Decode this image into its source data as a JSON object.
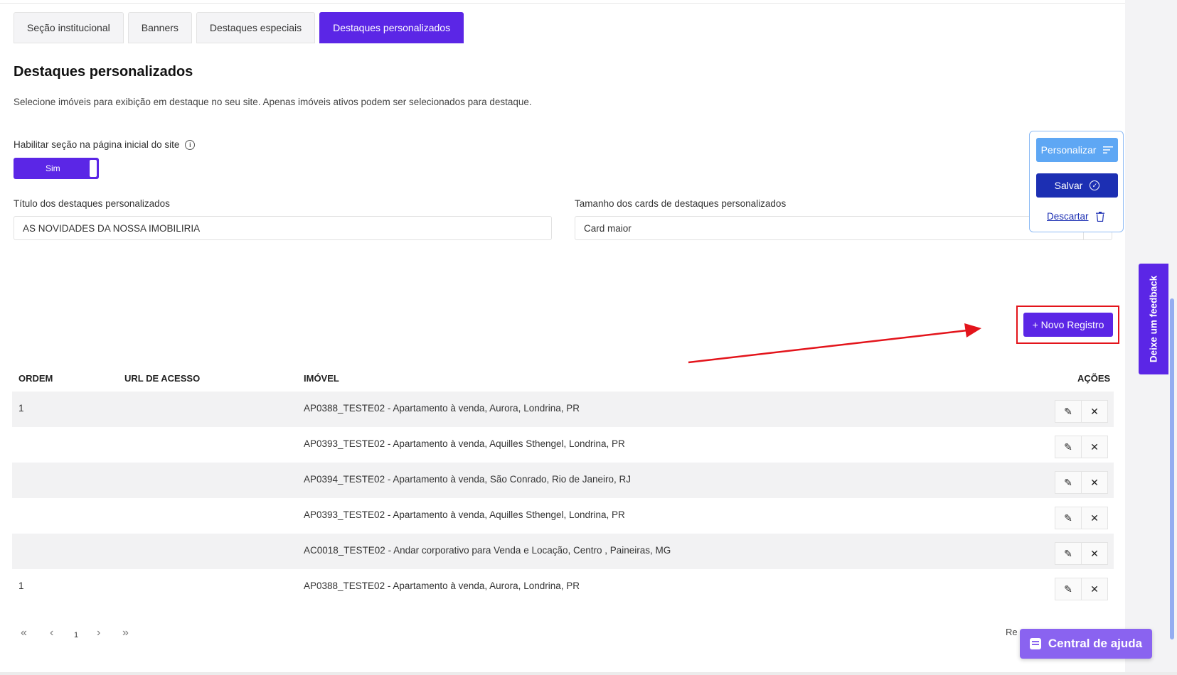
{
  "tabs": [
    {
      "label": "Seção institucional",
      "active": false
    },
    {
      "label": "Banners",
      "active": false
    },
    {
      "label": "Destaques especiais",
      "active": false
    },
    {
      "label": "Destaques personalizados",
      "active": true
    }
  ],
  "page": {
    "title": "Destaques personalizados",
    "description": "Selecione imóveis para exibição em destaque no seu site. Apenas imóveis ativos podem ser selecionados para destaque."
  },
  "toggle": {
    "label": "Habilitar seção na página inicial do site",
    "value": "Sim"
  },
  "fields": {
    "title_label": "Título dos destaques personalizados",
    "title_value": "AS NOVIDADES DA NOSSA IMOBILIRIA",
    "size_label": "Tamanho dos cards de destaques personalizados",
    "size_value": "Card maior"
  },
  "actions": {
    "personalizar": "Personalizar",
    "salvar": "Salvar",
    "descartar": "Descartar"
  },
  "novo_registro": "+ Novo Registro",
  "table": {
    "headers": {
      "ordem": "ORDEM",
      "url": "URL DE ACESSO",
      "imovel": "IMÓVEL",
      "acoes": "AÇÕES"
    },
    "rows": [
      {
        "ordem": "1",
        "url": "",
        "imovel": "AP0388_TESTE02 - Apartamento à venda, Aurora, Londrina, PR"
      },
      {
        "ordem": "",
        "url": "",
        "imovel": "AP0393_TESTE02 - Apartamento à venda, Aquilles Sthengel, Londrina, PR"
      },
      {
        "ordem": "",
        "url": "",
        "imovel": "AP0394_TESTE02 - Apartamento à venda, São Conrado, Rio de Janeiro, RJ"
      },
      {
        "ordem": "",
        "url": "",
        "imovel": "AP0393_TESTE02 - Apartamento à venda, Aquilles Sthengel, Londrina, PR"
      },
      {
        "ordem": "",
        "url": "",
        "imovel": "AC0018_TESTE02 - Andar corporativo para Venda e Locação, Centro , Paineiras, MG"
      },
      {
        "ordem": "1",
        "url": "",
        "imovel": "AP0388_TESTE02 - Apartamento à venda, Aurora, Londrina, PR"
      }
    ]
  },
  "pagination": {
    "first": "«",
    "prev": "‹",
    "page": "1",
    "next": "›",
    "last": "»",
    "records_text": "Re"
  },
  "help_button": "Central de ajuda",
  "feedback_tab": "Deixe um feedback"
}
